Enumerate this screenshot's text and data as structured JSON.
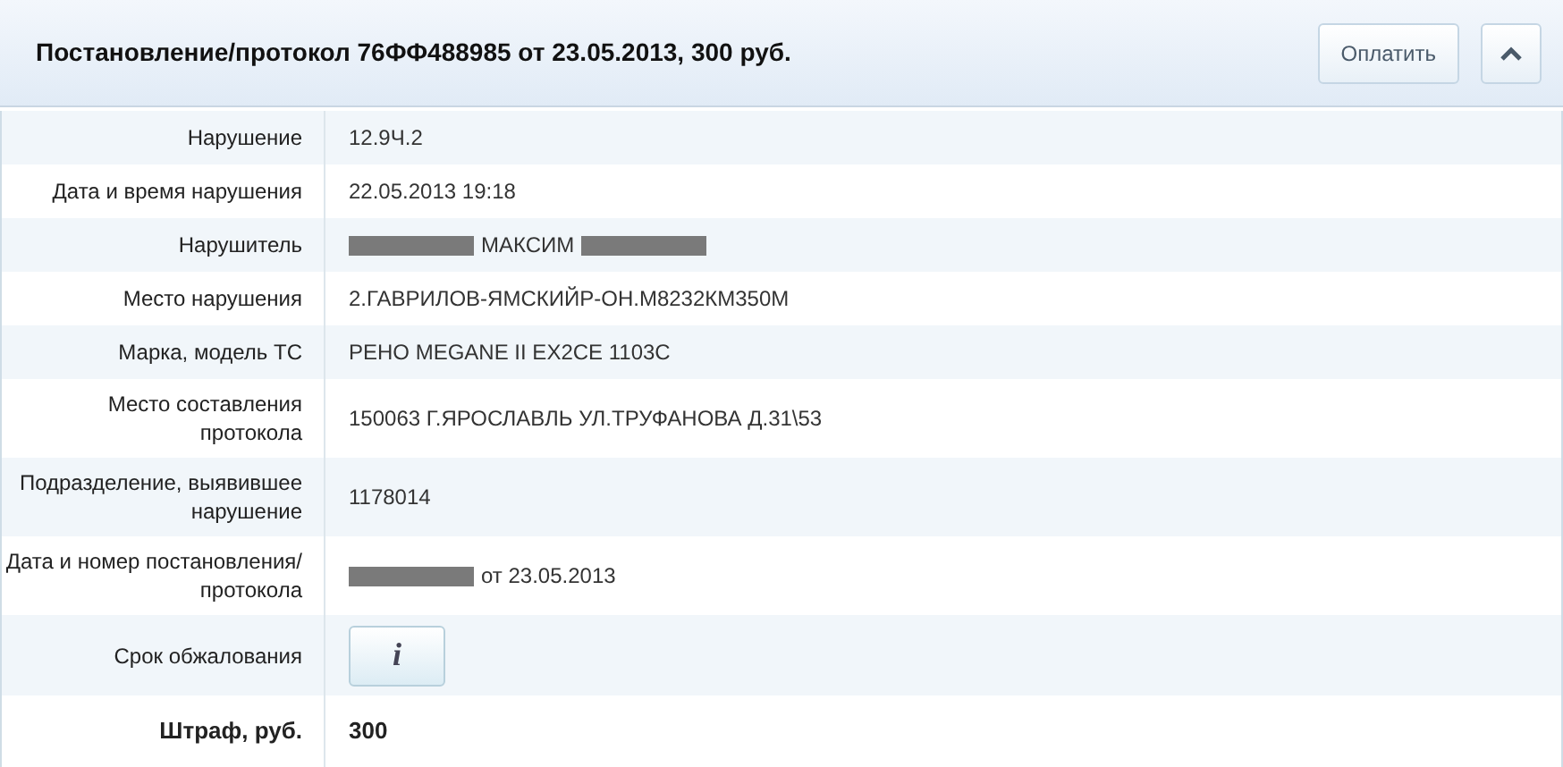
{
  "header": {
    "title": "Постановление/протокол 76ФФ488985 от 23.05.2013, 300 руб.",
    "pay_button": "Оплатить",
    "collapse_button": {
      "expanded": true
    }
  },
  "rows": [
    {
      "label": "Нарушение",
      "kind": "text",
      "value": [
        {
          "kind": "text",
          "text": "12.9Ч.2"
        }
      ]
    },
    {
      "label": "Дата и время нарушения",
      "kind": "text",
      "value": [
        {
          "kind": "text",
          "text": "22.05.2013 19:18"
        }
      ]
    },
    {
      "label": "Нарушитель",
      "kind": "text",
      "value": [
        {
          "kind": "redacted"
        },
        {
          "kind": "text",
          "text": "МАКСИМ"
        },
        {
          "kind": "redacted"
        }
      ]
    },
    {
      "label": "Место нарушения",
      "kind": "text",
      "value": [
        {
          "kind": "text",
          "text": "2.ГАВРИЛОВ-ЯМСКИЙР-ОН.М8232КМ350М"
        }
      ]
    },
    {
      "label": "Марка, модель ТС",
      "kind": "text",
      "value": [
        {
          "kind": "text",
          "text": "РЕНО MEGANE II EX2CE 1103C"
        }
      ]
    },
    {
      "label": "Место составления протокола",
      "kind": "text",
      "value": [
        {
          "kind": "text",
          "text": "150063 Г.ЯРОСЛАВЛЬ УЛ.ТРУФАНОВА Д.31\\53"
        }
      ]
    },
    {
      "label": "Подразделение, выявившее нарушение",
      "kind": "text",
      "value": [
        {
          "kind": "text",
          "text": "1178014"
        }
      ]
    },
    {
      "label": "Дата и номер постановления/протокола",
      "kind": "text",
      "value": [
        {
          "kind": "redacted"
        },
        {
          "kind": "text",
          "text": "от 23.05.2013"
        }
      ]
    },
    {
      "label": "Срок обжалования",
      "kind": "info",
      "button": "i"
    },
    {
      "label": "Штраф, руб.",
      "kind": "total",
      "value": [
        {
          "kind": "text",
          "text": "300"
        }
      ]
    }
  ]
}
